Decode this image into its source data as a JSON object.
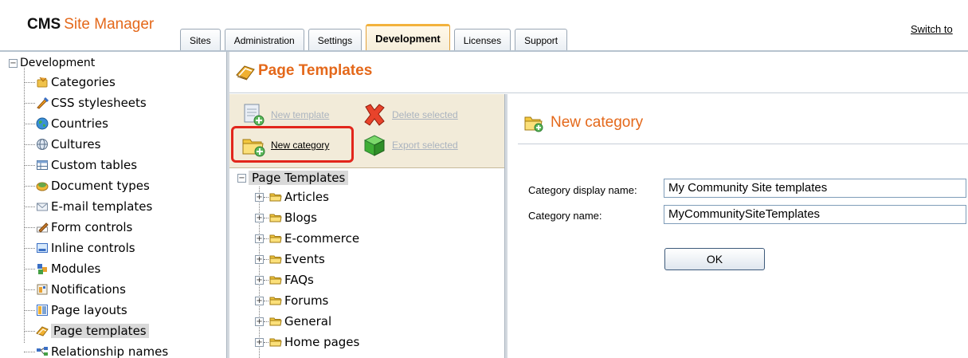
{
  "header": {
    "logo_cms": "CMS",
    "logo_site_manager": "Site Manager",
    "tabs": [
      {
        "label": "Sites",
        "active": false
      },
      {
        "label": "Administration",
        "active": false
      },
      {
        "label": "Settings",
        "active": false
      },
      {
        "label": "Development",
        "active": true
      },
      {
        "label": "Licenses",
        "active": false
      },
      {
        "label": "Support",
        "active": false
      }
    ],
    "switch_link": "Switch to"
  },
  "left_tree": {
    "root": {
      "label": "Development",
      "expander": "−"
    },
    "items": [
      {
        "label": "Categories",
        "icon": "categories-icon"
      },
      {
        "label": "CSS stylesheets",
        "icon": "css-stylesheets-icon"
      },
      {
        "label": "Countries",
        "icon": "countries-icon"
      },
      {
        "label": "Cultures",
        "icon": "cultures-icon"
      },
      {
        "label": "Custom tables",
        "icon": "custom-tables-icon"
      },
      {
        "label": "Document types",
        "icon": "document-types-icon"
      },
      {
        "label": "E-mail templates",
        "icon": "email-templates-icon"
      },
      {
        "label": "Form controls",
        "icon": "form-controls-icon"
      },
      {
        "label": "Inline controls",
        "icon": "inline-controls-icon"
      },
      {
        "label": "Modules",
        "icon": "modules-icon"
      },
      {
        "label": "Notifications",
        "icon": "notifications-icon"
      },
      {
        "label": "Page layouts",
        "icon": "page-layouts-icon"
      },
      {
        "label": "Page templates",
        "icon": "page-templates-icon",
        "selected": true
      },
      {
        "label": "Relationship names",
        "icon": "relationship-names-icon"
      }
    ]
  },
  "page": {
    "title": "Page Templates",
    "actions": {
      "new_template": "New template",
      "delete_selected": "Delete selected",
      "new_category": "New category",
      "export_selected": "Export selected"
    }
  },
  "mid_tree": {
    "root": {
      "label": "Page Templates",
      "expander": "−"
    },
    "items": [
      {
        "label": "Articles",
        "expander": "+"
      },
      {
        "label": "Blogs",
        "expander": "+"
      },
      {
        "label": "E-commerce",
        "expander": "+"
      },
      {
        "label": "Events",
        "expander": "+"
      },
      {
        "label": "FAQs",
        "expander": "+"
      },
      {
        "label": "Forums",
        "expander": "+"
      },
      {
        "label": "General",
        "expander": "+"
      },
      {
        "label": "Home pages",
        "expander": "+"
      }
    ]
  },
  "form": {
    "title": "New category",
    "display_name_label": "Category display name:",
    "display_name_value": "My Community Site templates",
    "name_label": "Category name:",
    "name_value": "MyCommunitySiteTemplates",
    "ok_label": "OK"
  },
  "colors": {
    "accent_orange": "#e4681a",
    "highlight_red": "#e2261c",
    "toolbar_bg": "#f2ebd9",
    "selection_gray": "#d9d9d9"
  }
}
